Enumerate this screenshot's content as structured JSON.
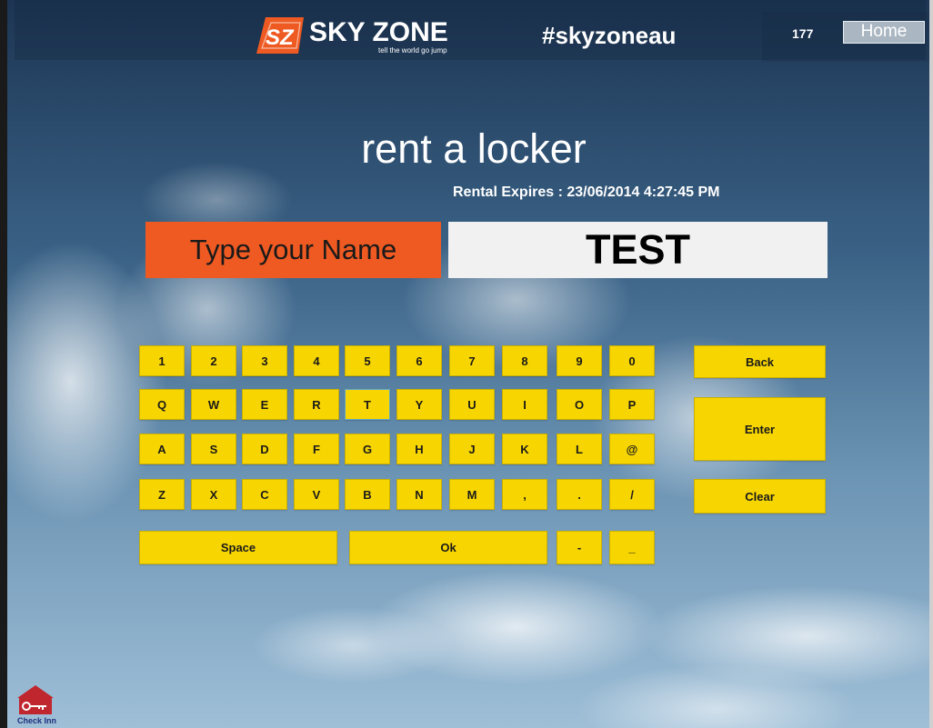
{
  "header": {
    "brand_name": "SKY ZONE",
    "brand_tagline": "tell the world go jump",
    "logo_text": "SZ",
    "hashtag": "#skyzoneau",
    "counter": "177",
    "home_label": "Home"
  },
  "main": {
    "title": "rent a locker",
    "rental_expires": "Rental Expires : 23/06/2014 4:27:45 PM",
    "name_label": "Type your Name",
    "name_value": "TEST"
  },
  "keyboard": {
    "row1": [
      "1",
      "2",
      "3",
      "4",
      "5",
      "6",
      "7",
      "8",
      "9",
      "0"
    ],
    "row2": [
      "Q",
      "W",
      "E",
      "R",
      "T",
      "Y",
      "U",
      "I",
      "O",
      "P"
    ],
    "row3": [
      "A",
      "S",
      "D",
      "F",
      "G",
      "H",
      "J",
      "K",
      "L",
      "@"
    ],
    "row4": [
      "Z",
      "X",
      "C",
      "V",
      "B",
      "N",
      "M",
      ",",
      ".",
      "/"
    ],
    "space_label": "Space",
    "ok_label": "Ok",
    "dash_label": "-",
    "underscore_label": "_",
    "back_label": "Back",
    "enter_label": "Enter",
    "clear_label": "Clear"
  },
  "footer": {
    "vendor_logo_text": "Check Inn"
  },
  "colors": {
    "accent_orange": "#ee5a22",
    "key_yellow": "#f7d500"
  }
}
